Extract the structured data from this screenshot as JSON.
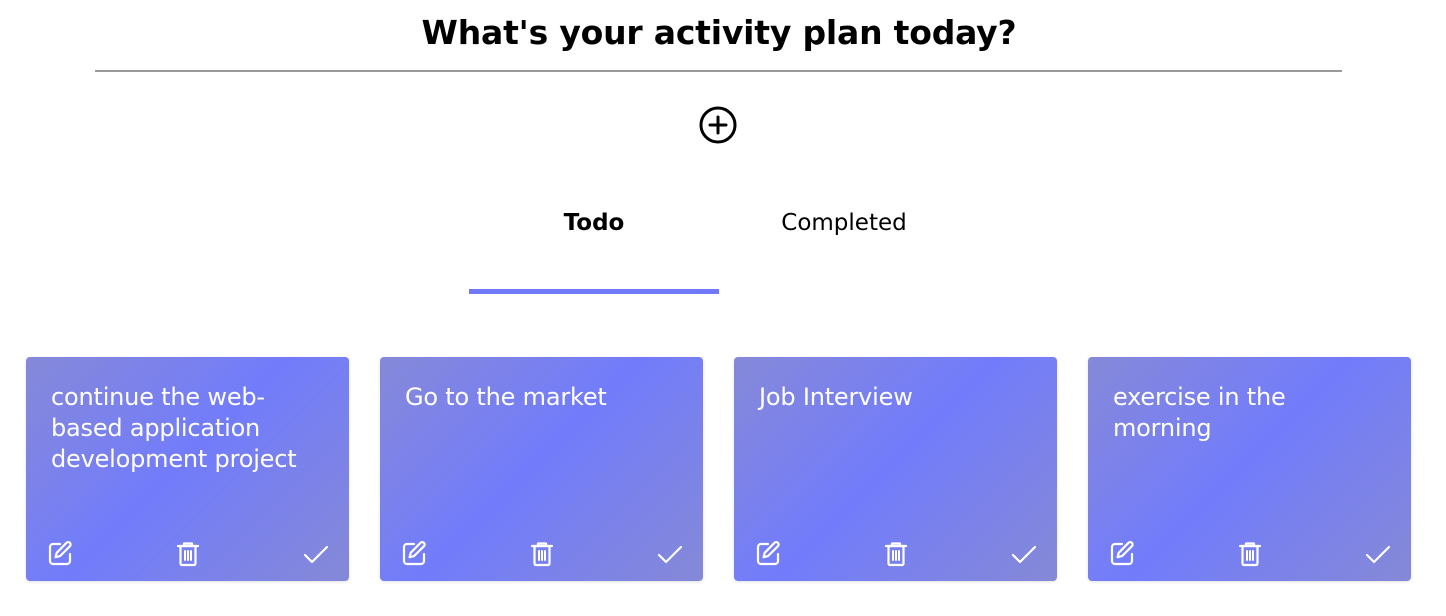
{
  "header": {
    "title": "What's your activity plan today?"
  },
  "add_button": {
    "icon": "plus-circle-icon"
  },
  "tabs": [
    {
      "label": "Todo",
      "active": true
    },
    {
      "label": "Completed",
      "active": false
    }
  ],
  "colors": {
    "accent": "#7079fa",
    "card_gradient": [
      "#8689d8",
      "#727cfb",
      "#8589d6"
    ],
    "divider": "#9a9a9a"
  },
  "cards": [
    {
      "text": "continue the web-based application development project"
    },
    {
      "text": "Go to the market"
    },
    {
      "text": "Job Interview"
    },
    {
      "text": "exercise in the morning"
    }
  ],
  "card_actions": [
    "edit-icon",
    "trash-icon",
    "check-icon"
  ]
}
